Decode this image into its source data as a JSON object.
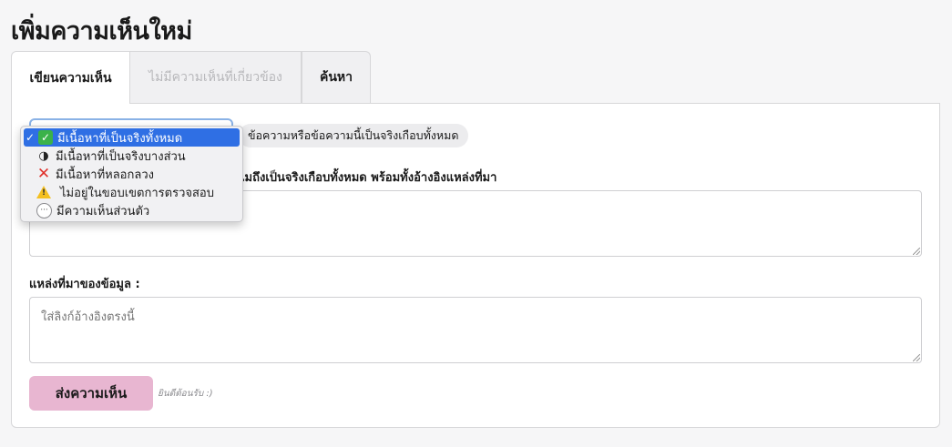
{
  "page": {
    "title": "เพิ่มความเห็นใหม่"
  },
  "tabs": [
    {
      "label": "เขียนความเห็น",
      "state": "active"
    },
    {
      "label": "ไม่มีความเห็นที่เกี่ยวข้อง",
      "state": "disabled"
    },
    {
      "label": "ค้นหา",
      "state": "normal"
    }
  ],
  "form": {
    "verdict_description": "ข้อความหรือข้อความนี้เป็นจริงเกือบทั้งหมด",
    "detail_label": "ไมถึงเป็นจริงเกือบทั้งหมด พร้อมทั้งอ้างอิงแหล่งที่มา",
    "detail_value": "",
    "source_label": "แหล่งที่มาของข้อมูล :",
    "source_placeholder": "ใส่ลิงก์อ้างอิงตรงนี้",
    "submit_label": "ส่งความเห็น",
    "welcome_note": "ยินดีต้อนรับ :)"
  },
  "dropdown": {
    "checkmark": "✓",
    "options": [
      {
        "label": "มีเนื้อหาที่เป็นจริงทั้งหมด",
        "icon": "check-mark-icon",
        "selected": true
      },
      {
        "label": "มีเนื้อหาที่เป็นจริงบางส่วน",
        "icon": "half-circle-icon",
        "selected": false
      },
      {
        "label": "มีเนื้อหาที่หลอกลวง",
        "icon": "cross-icon",
        "selected": false
      },
      {
        "label": "ไม่อยู่ในขอบเขตการตรวจสอบ",
        "icon": "warning-icon",
        "selected": false
      },
      {
        "label": "มีความเห็นส่วนตัว",
        "icon": "speech-bubble-icon",
        "selected": false
      }
    ]
  },
  "colors": {
    "accent": "#2f6fe4",
    "submit": "#e8b6d1",
    "success": "#3bb24a",
    "error": "#e0302a",
    "warning": "#f4c020"
  }
}
